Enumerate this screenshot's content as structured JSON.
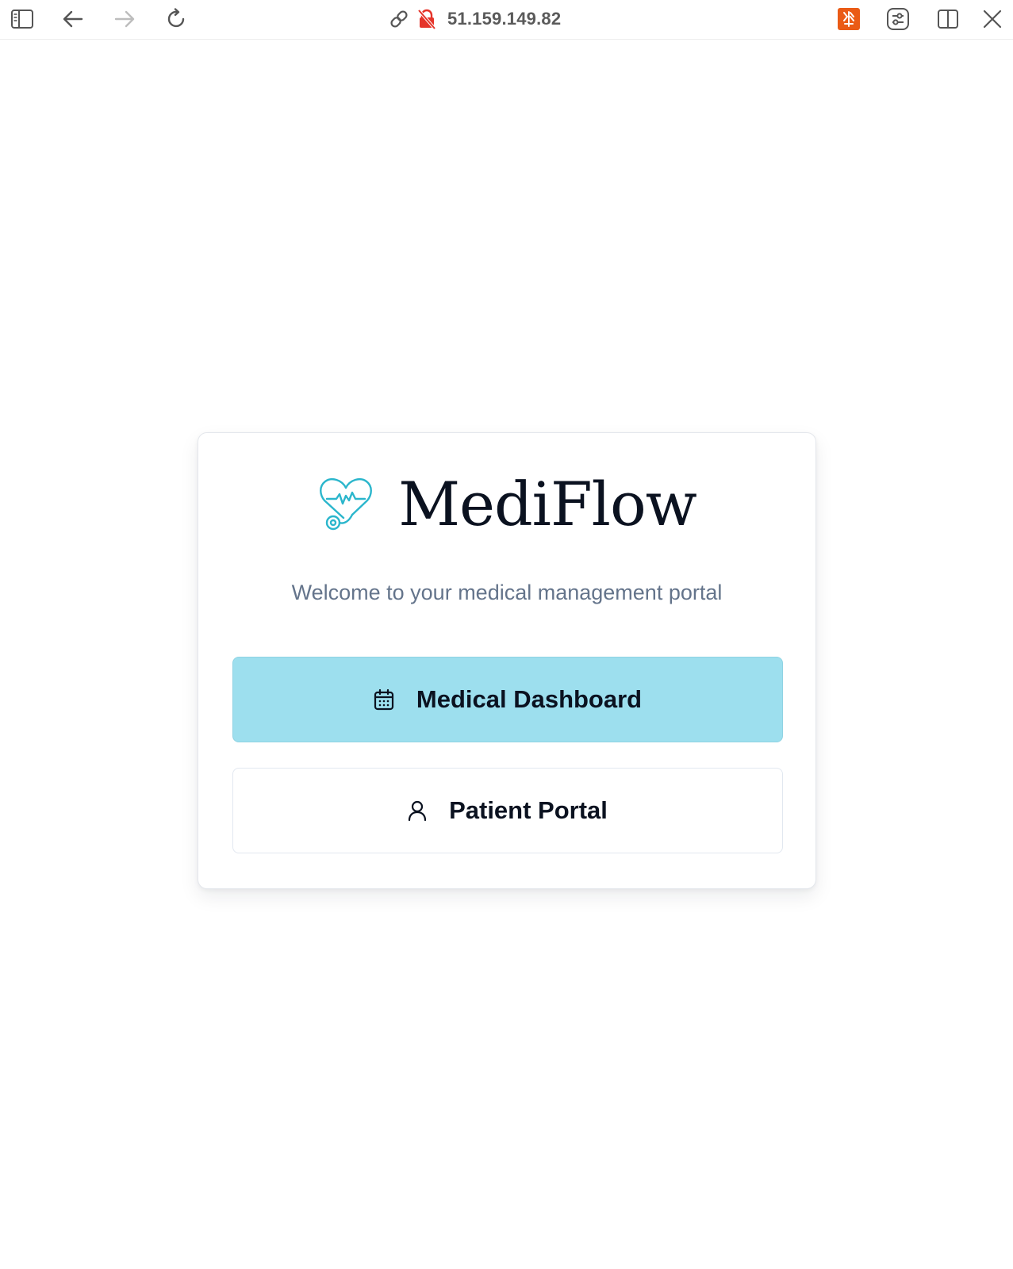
{
  "browser": {
    "address": "51.159.149.82",
    "icons": {
      "sidebar": "sidebar-icon",
      "back": "arrow-left-icon",
      "forward": "arrow-right-icon",
      "reload": "reload-icon",
      "link": "link-icon",
      "insecure": "insecure-lock-icon",
      "extension": "extension-icon",
      "settings": "sliders-icon",
      "split": "split-view-icon",
      "close": "close-icon"
    },
    "colors": {
      "insecure": "#e5342a",
      "extension": "#ea5b16"
    }
  },
  "card": {
    "brand_name": "MediFlow",
    "brand_icon": "stethoscope-heart-icon",
    "subtitle": "Welcome to your medical management portal",
    "buttons": [
      {
        "label": "Medical Dashboard",
        "icon": "calendar-icon"
      },
      {
        "label": "Patient Portal",
        "icon": "user-icon"
      }
    ],
    "colors": {
      "accent": "#9ddfee",
      "logo": "#2bb6cc",
      "heading": "#0b1220",
      "subtitle": "#64748b"
    }
  }
}
